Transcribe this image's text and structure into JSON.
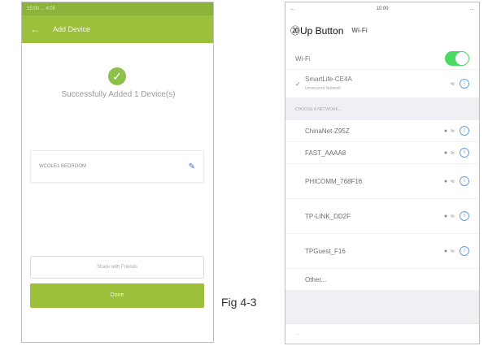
{
  "caption": "Fig 4-3",
  "left_phone": {
    "status_bar": "15:00 ... 4:00",
    "header_title": "Add Device",
    "back_icon": "back-arrow-icon",
    "success_message": "Successfully Added 1 Device(s)",
    "device_name": "WCOLE1 BEDROOM",
    "share_button": "Share with Friends",
    "done_button": "Done",
    "colors": {
      "primary": "#9cc03a",
      "success": "#8dc04a",
      "edit": "#4a63c9"
    }
  },
  "right_phone": {
    "status_bar": {
      "left": "...",
      "time": "10:00",
      "right": "..."
    },
    "up_marker": "⑳Up Button",
    "nav_title": "Wi-Fi",
    "wifi_label": "Wi-Fi",
    "wifi_enabled": true,
    "connected": {
      "name": "SmartLife-CE4A",
      "subtitle": "Unsecured Network"
    },
    "section_header": "CHOOSE A NETWORK...",
    "networks": [
      {
        "name": "ChinaNet-Z95Z",
        "locked": true
      },
      {
        "name": "FAST_AAAA8",
        "locked": true
      },
      {
        "name": "PHICOMM_768F16",
        "locked": true
      },
      {
        "name": "TP-LINK_DD2F",
        "locked": true
      },
      {
        "name": "TPGuest_F16",
        "locked": true
      }
    ],
    "other_label": "Other...",
    "bottom_text": "...",
    "colors": {
      "toggle_on": "#4cd964",
      "info": "#6aa0dd"
    }
  }
}
